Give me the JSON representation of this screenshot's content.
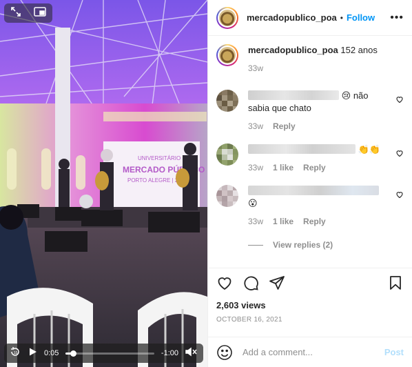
{
  "video": {
    "current_time": "0:05",
    "remaining_time": "-1:00",
    "progress": 0.08,
    "banner_text": "UNIVERSITÁRIO",
    "banner_title": "MERCADO PÚBLICO",
    "banner_sub": "PORTO ALEGRE | 2021",
    "icons": {
      "expand": "expand-icon",
      "pip": "picture-in-picture-icon",
      "replay": "replay-10-icon",
      "play": "play-icon",
      "mute": "mute-icon"
    }
  },
  "header": {
    "username": "mercadopublico_poa",
    "separator": "•",
    "follow_label": "Follow",
    "more_label": "•••"
  },
  "caption": {
    "username": "mercadopublico_poa",
    "text": "152 anos",
    "time": "33w"
  },
  "comments": [
    {
      "emoji": "😢",
      "text": "não sabia que chato",
      "time": "33w",
      "likes": "",
      "reply_label": "Reply"
    },
    {
      "emoji": "👏👏",
      "text": "",
      "time": "33w",
      "likes": "1 like",
      "reply_label": "Reply"
    },
    {
      "emoji": "😮",
      "text": "",
      "time": "33w",
      "likes": "1 like",
      "reply_label": "Reply"
    }
  ],
  "view_replies": "View replies (2)",
  "stats": {
    "views": "2,603 views",
    "date": "OCTOBER 16, 2021"
  },
  "composer": {
    "placeholder": "Add a comment...",
    "post_label": "Post"
  },
  "colors": {
    "accent": "#0095f6",
    "post_disabled": "#b2dffc",
    "muted": "#8e8e8e"
  }
}
